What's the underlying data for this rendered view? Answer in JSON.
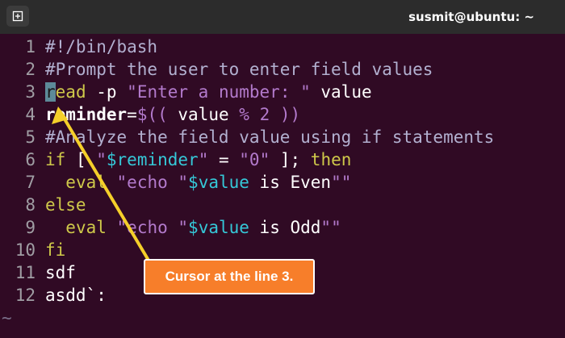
{
  "window": {
    "title": "susmit@ubuntu: ~",
    "new_tab_icon": "new-tab-icon"
  },
  "editor": {
    "lines": [
      {
        "n": "1",
        "segs": [
          [
            "cm",
            "#!/bin/bash"
          ]
        ]
      },
      {
        "n": "2",
        "segs": [
          [
            "cm",
            "#Prompt the user to enter field values"
          ]
        ]
      },
      {
        "n": "3",
        "segs": [
          [
            "cursor",
            "r"
          ],
          [
            "kw",
            "ead"
          ],
          [
            "code",
            " -p "
          ],
          [
            "str",
            "\"Enter a number: \""
          ],
          [
            "code",
            " value"
          ]
        ]
      },
      {
        "n": "4",
        "segs": [
          [
            "bold",
            "reminder"
          ],
          [
            "code",
            "="
          ],
          [
            "str",
            "$(("
          ],
          [
            "code",
            " value "
          ],
          [
            "str",
            "%"
          ],
          [
            "code",
            " "
          ],
          [
            "str",
            "2"
          ],
          [
            "code",
            " "
          ],
          [
            "str",
            "))"
          ]
        ]
      },
      {
        "n": "5",
        "segs": [
          [
            "cm",
            "#Analyze the field value using if statements"
          ]
        ]
      },
      {
        "n": "6",
        "segs": [
          [
            "kw",
            "if"
          ],
          [
            "code",
            " [ "
          ],
          [
            "str",
            "\""
          ],
          [
            "var",
            "$reminder"
          ],
          [
            "str",
            "\""
          ],
          [
            "code",
            " = "
          ],
          [
            "str",
            "\"0\""
          ],
          [
            "code",
            " ]; "
          ],
          [
            "kw",
            "then"
          ]
        ]
      },
      {
        "n": "7",
        "segs": [
          [
            "code",
            "  "
          ],
          [
            "kw",
            "eval"
          ],
          [
            "code",
            " "
          ],
          [
            "str",
            "\"echo \""
          ],
          [
            "var",
            "$value"
          ],
          [
            "code",
            " is Even"
          ],
          [
            "str",
            "\"\""
          ]
        ]
      },
      {
        "n": "8",
        "segs": [
          [
            "kw",
            "else"
          ]
        ]
      },
      {
        "n": "9",
        "segs": [
          [
            "code",
            "  "
          ],
          [
            "kw",
            "eval"
          ],
          [
            "code",
            " "
          ],
          [
            "str",
            "\"echo \""
          ],
          [
            "var",
            "$value"
          ],
          [
            "code",
            " is Odd"
          ],
          [
            "str",
            "\"\""
          ]
        ]
      },
      {
        "n": "10",
        "segs": [
          [
            "kw",
            "fi"
          ]
        ]
      },
      {
        "n": "11",
        "segs": [
          [
            "code",
            "sdf"
          ]
        ]
      },
      {
        "n": "12",
        "segs": [
          [
            "code",
            "asdd`:"
          ]
        ]
      }
    ],
    "empty_line_marker": "~"
  },
  "annotation": {
    "label": "Cursor at the line 3.",
    "color": "#f77e2a",
    "arrow_color": "#f5cf2a"
  }
}
